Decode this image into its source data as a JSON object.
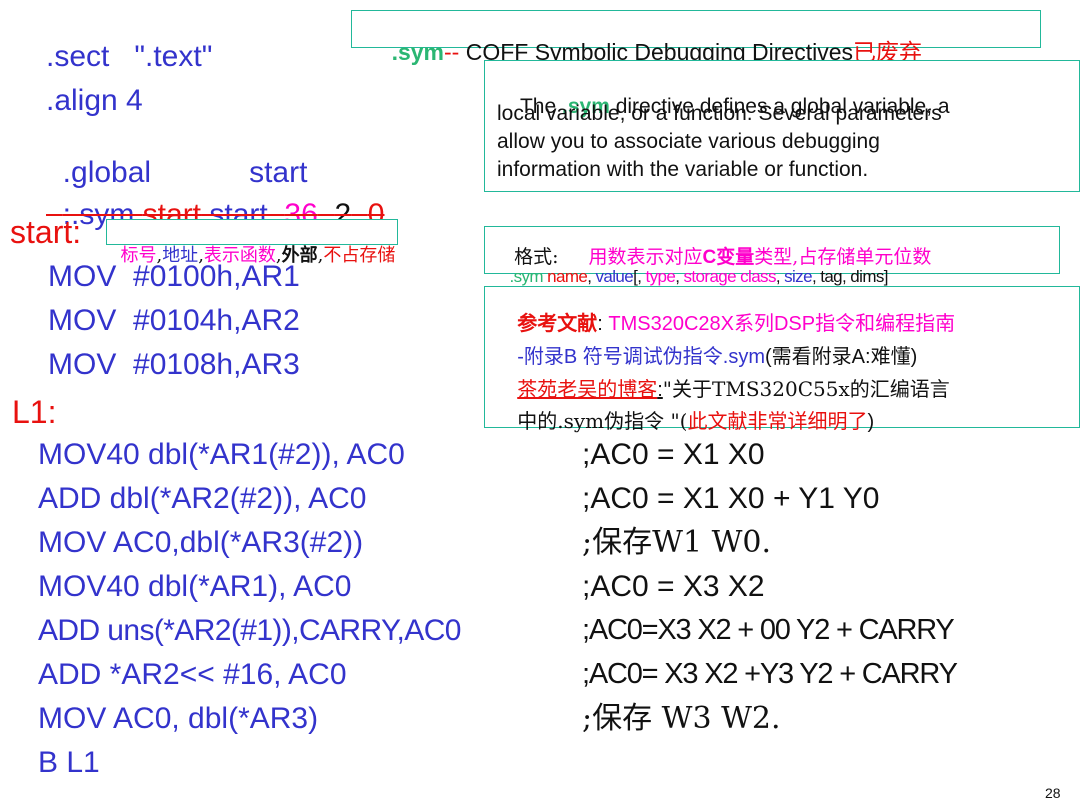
{
  "title_box": {
    "sym": ".sym",
    "dashes": "--",
    "text": " COFF Symbolic Debugging Directives",
    "deprecated": "已废弃"
  },
  "directives": {
    "sect": ".sect   \".text\"",
    "align": ".align 4",
    "global_kw": ".global",
    "global_val": "start",
    "sym_prefix": ";.sym ",
    "sym_name": "start",
    "sym_value": ",start, ",
    "sym_type": "36",
    "sym_sep1": ", ",
    "sym_storage": "2",
    "sym_sep2": ", ",
    "sym_size": "0"
  },
  "start_label": "start:",
  "start_note": {
    "label": "标号",
    "sep1": ",",
    "addr": "地址",
    "sep2": ",",
    "func": "表示函数",
    "sep3": ",",
    "extern": "外部",
    "sep4": ",",
    "nostore": "不占存储"
  },
  "desc_box": {
    "line1_pre": "The ",
    "line1_sym": ".sym",
    "line1_post": " directive defines a global variable, a",
    "line2": "local variable, or a function. Several parameters",
    "line3": "allow you to associate various debugging",
    "line4": "information with the variable or function."
  },
  "format_box": {
    "label": "格式:",
    "desc_pre": "用数表示对应",
    "desc_c": "C变量",
    "desc_post": "类型,占存储单元位数",
    "syn_sym": ".sym ",
    "syn_name": "name",
    "syn_c1": ", ",
    "syn_value": "value",
    "syn_br": "[, ",
    "syn_type": "type",
    "syn_c2": ", ",
    "syn_storage": "storage class",
    "syn_c3": ", ",
    "syn_size": "size",
    "syn_c4": ", ",
    "syn_tag": "tag",
    "syn_c5": ", ",
    "syn_dims": "dims]"
  },
  "ref_box": {
    "ref_label": "参考文献",
    "ref_colon": ": ",
    "ref_l1": "TMS320C28X系列DSP指令和编程指南",
    "ref_l2a": "-附录B 符号调试伪指令.sym",
    "ref_l2b": "(需看附录A:难懂)",
    "ref_l3a": "茶苑老吴的博客",
    "ref_l3b": ":",
    "ref_l3c": "\"关于TMS320C55x的汇编语言",
    "ref_l4a": "中的.sym伪指令 \"(",
    "ref_l4b": "此文献非常详细明了",
    "ref_l4c": ")"
  },
  "moves": [
    "MOV  #0100h,AR1",
    "MOV  #0104h,AR2",
    "MOV  #0108h,AR3"
  ],
  "l1_label": "L1:",
  "instructions": [
    {
      "code": "MOV40 dbl(*AR1(#2)), AC0",
      "comment": ";AC0 = X1 X0"
    },
    {
      "code": "ADD dbl(*AR2(#2)), AC0",
      "comment": ";AC0 = X1 X0 + Y1 Y0"
    },
    {
      "code": "MOV AC0,dbl(*AR3(#2))",
      "comment": ";保存W1 W0."
    },
    {
      "code": "MOV40 dbl(*AR1), AC0",
      "comment": ";AC0 = X3 X2"
    },
    {
      "code": "ADD uns(*AR2(#1)),CARRY,AC0",
      "comment": ";AC0=X3 X2 + 00 Y2 + CARRY"
    },
    {
      "code": "ADD *AR2<< #16, AC0",
      "comment": ";AC0= X3 X2 +Y3 Y2 + CARRY"
    },
    {
      "code": "MOV AC0, dbl(*AR3)",
      "comment": ";保存 W3 W2."
    }
  ],
  "branch": "B L1",
  "page_number": "28",
  "colors": {
    "code_blue": "#3333cc",
    "accent_red": "#e8110f",
    "accent_magenta": "#ff00cc",
    "box_border": "#22b89a",
    "sym_green": "#2bb673"
  }
}
